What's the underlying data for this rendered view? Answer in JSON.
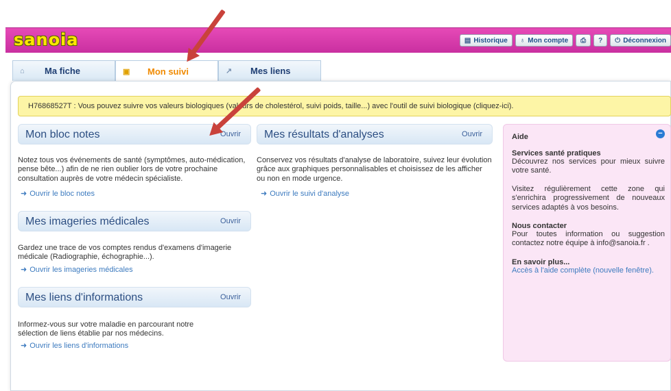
{
  "app": {
    "logo": "sanoia"
  },
  "topnav": [
    {
      "icon": "▤",
      "label": "Historique"
    },
    {
      "icon": "♁",
      "label": "Mon compte"
    },
    {
      "icon": "⎙",
      "label": ""
    },
    {
      "icon": "?",
      "label": ""
    },
    {
      "icon": "⏻",
      "label": "Déconnexion"
    }
  ],
  "tabs": [
    {
      "icon": "⌂",
      "label": "Ma fiche"
    },
    {
      "icon": "▣",
      "label": "Mon suivi"
    },
    {
      "icon": "↗",
      "label": "Mes liens"
    }
  ],
  "notice": "H76868527T : Vous pouvez suivre vos valeurs biologiques (valeurs de cholestérol, suivi poids, taille...) avec l'outil de suivi biologique (cliquez-ici).",
  "sections": {
    "bloc_notes": {
      "title": "Mon bloc notes",
      "open": "Ouvrir",
      "text": "Notez tous vos événements de santé (symptômes, auto-médication, pense bête...) afin de ne rien oublier lors de votre prochaine consultation auprès de votre médecin spécialiste.",
      "link": "Ouvrir le bloc notes"
    },
    "imageries": {
      "title": "Mes imageries médicales",
      "open": "Ouvrir",
      "text": "Gardez une trace de vos comptes rendus d'examens d'imagerie médicale (Radiographie, échographie...).",
      "link": "Ouvrir les imageries médicales"
    },
    "liens": {
      "title": "Mes liens d'informations",
      "open": "Ouvrir",
      "text": "Informez-vous sur votre maladie en parcourant notre sélection de liens établie par nos médecins.",
      "link": "Ouvrir les liens d'informations"
    },
    "resultats": {
      "title": "Mes résultats d'analyses",
      "open": "Ouvrir",
      "text": "Conservez vos résultats d'analyse de laboratoire, suivez leur évolution grâce aux graphiques personnalisables et choisissez de les afficher ou non en mode urgence.",
      "link": "Ouvrir le suivi d'analyse"
    }
  },
  "aide": {
    "title": "Aide",
    "h1": "Services santé pratiques",
    "p1": "Découvrez nos services pour mieux suivre votre santé.",
    "p2": "Visitez régulièrement cette zone qui s'enrichira progressivement de nouveaux services adaptés à vos besoins.",
    "h2": "Nous contacter",
    "p3": "Pour toutes information ou suggestion contactez notre équipe à info@sanoia.fr .",
    "h3": "En savoir plus...",
    "link": "Accès à l'aide complète (nouvelle fenêtre)."
  },
  "colors": {
    "brand": "#d63aaa",
    "logo": "#ffe600",
    "accent_tab": "#f08a00",
    "arrow": "#c9423b",
    "notice_bg": "#fdf5a6",
    "aide_bg": "#fbe6f6"
  }
}
